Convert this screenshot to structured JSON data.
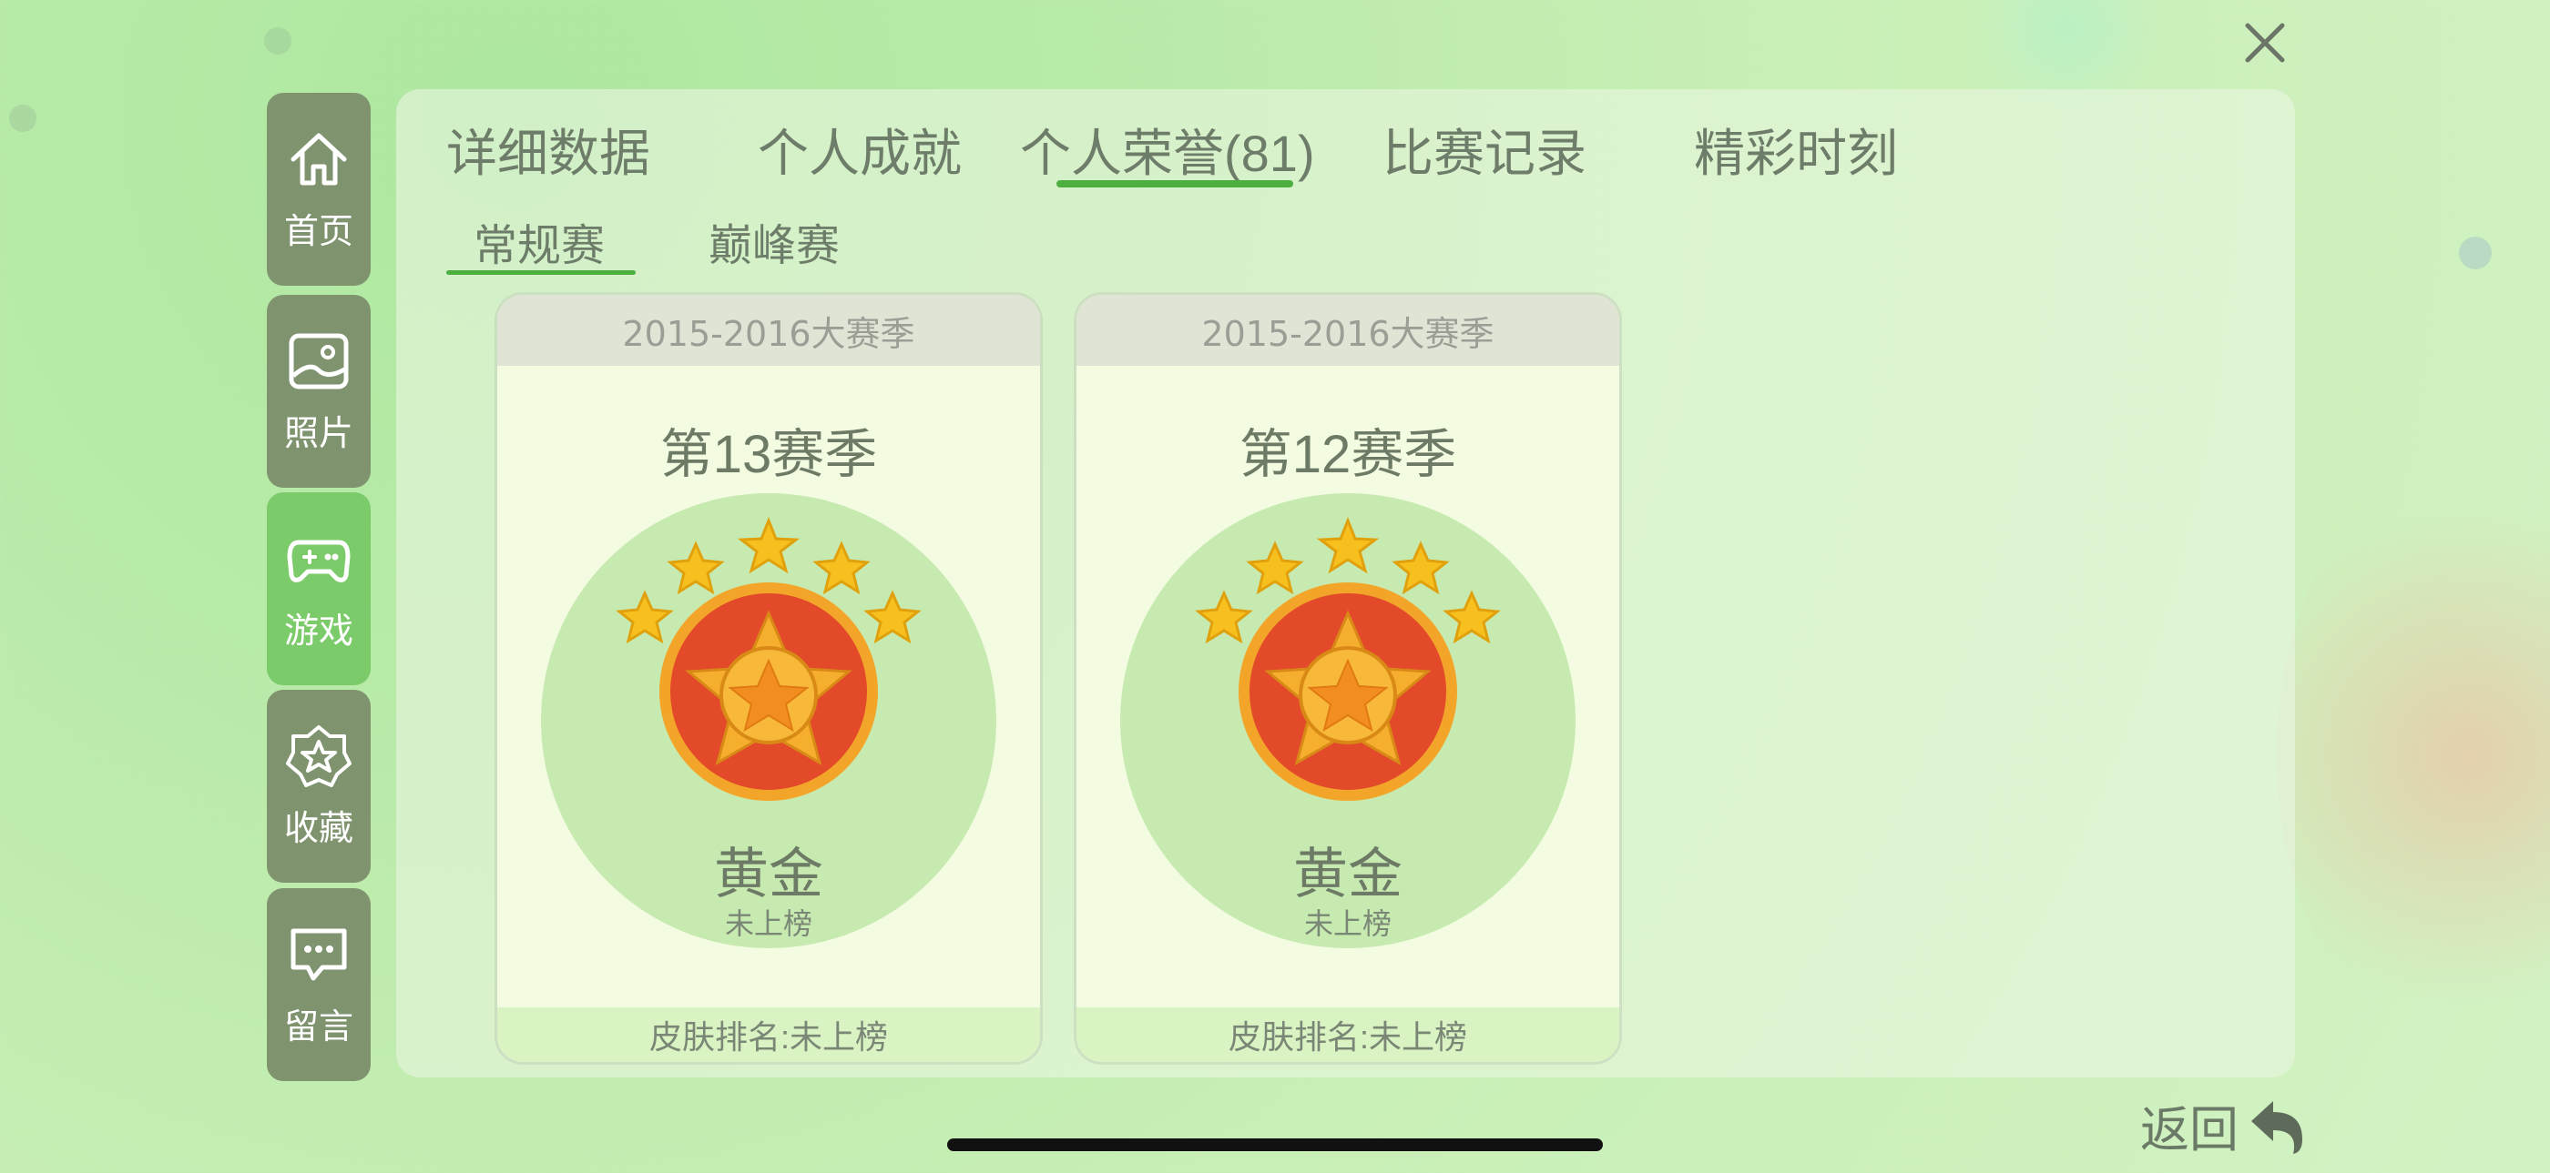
{
  "colors": {
    "accent": "#4daf3f",
    "nav_bg": "#7f936f",
    "nav_active": "#7ccb6a",
    "text": "#6e7d69"
  },
  "nav": [
    {
      "label": "首页",
      "icon": "home-icon"
    },
    {
      "label": "照片",
      "icon": "photo-icon"
    },
    {
      "label": "游戏",
      "icon": "gamepad-icon",
      "active": true
    },
    {
      "label": "收藏",
      "icon": "star-badge-icon"
    },
    {
      "label": "留言",
      "icon": "message-icon"
    }
  ],
  "tabs": [
    {
      "label": "详细数据"
    },
    {
      "label": "个人成就"
    },
    {
      "label": "个人荣誉(81)",
      "active": true
    },
    {
      "label": "比赛记录"
    },
    {
      "label": "精彩时刻"
    }
  ],
  "subtabs": [
    {
      "label": "常规赛",
      "active": true
    },
    {
      "label": "巅峰赛"
    }
  ],
  "cards": [
    {
      "header": "2015-2016大赛季",
      "season": "第13赛季",
      "tier": "黄金",
      "rank": "未上榜",
      "footer": "皮肤排名:未上榜",
      "stars": 5
    },
    {
      "header": "2015-2016大赛季",
      "season": "第12赛季",
      "tier": "黄金",
      "rank": "未上榜",
      "footer": "皮肤排名:未上榜",
      "stars": 5
    }
  ],
  "back_label": "返回",
  "close_icon": "close-icon"
}
